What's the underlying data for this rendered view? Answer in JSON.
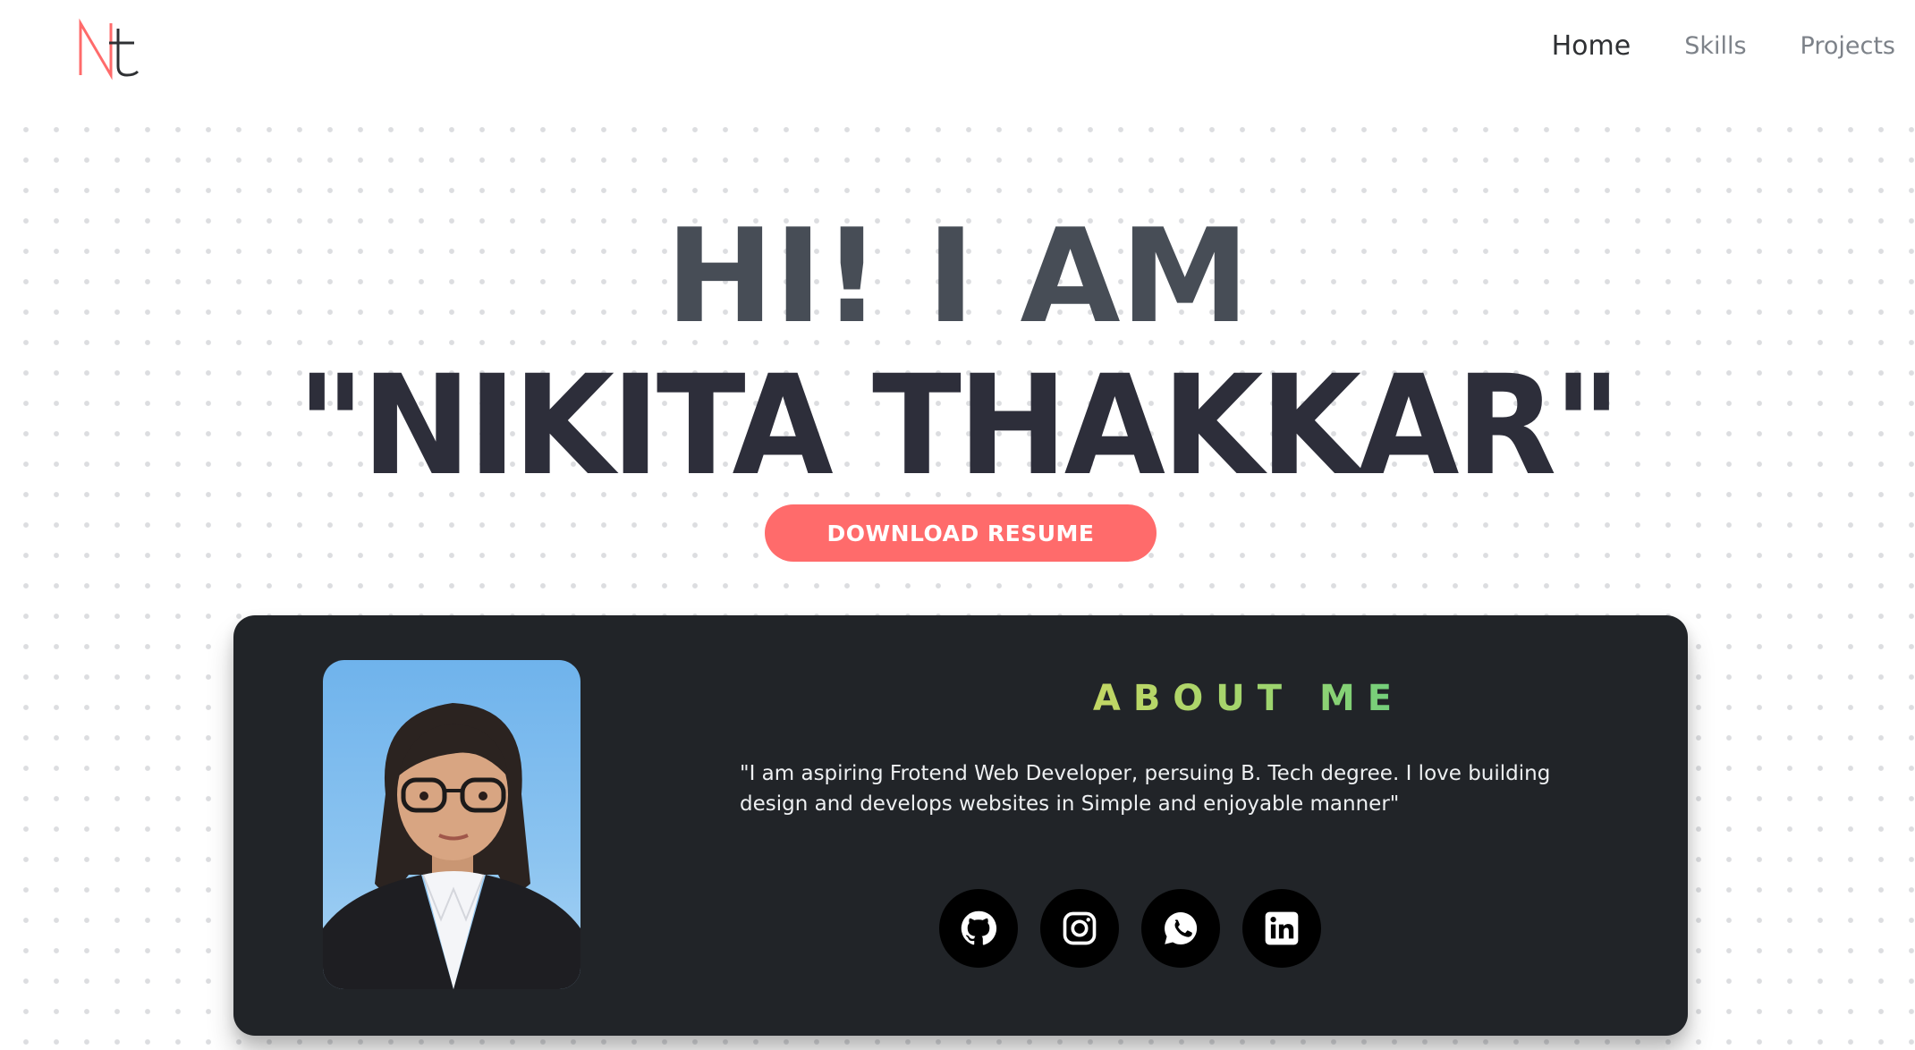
{
  "colors": {
    "accent": "#ff6b6b",
    "card_background": "#212428",
    "headline_line1": "#474d56",
    "headline_line2": "#2d2e3a",
    "title_gradient": [
      "#e8d85a",
      "#9bd46f",
      "#2ec58f"
    ]
  },
  "logo": {
    "icon": "nt-monogram-logo",
    "text": "Nt"
  },
  "nav": {
    "items": [
      {
        "label": "Home",
        "active": true
      },
      {
        "label": "Skills",
        "active": false
      },
      {
        "label": "Projects",
        "active": false
      }
    ]
  },
  "hero": {
    "line1": "HI! I AM",
    "line2": "\"NIKITA THAKKAR\"",
    "button_label": "DOWNLOAD RESUME"
  },
  "about": {
    "title": "ABOUT ME",
    "text": "\"I am aspiring Frotend Web Developer, persuing B. Tech degree. I love building design and develops websites in Simple and enjoyable manner\"",
    "photo_icon": "profile-photo",
    "socials": [
      {
        "icon": "github-icon"
      },
      {
        "icon": "instagram-icon"
      },
      {
        "icon": "whatsapp-icon"
      },
      {
        "icon": "linkedin-icon"
      }
    ]
  }
}
